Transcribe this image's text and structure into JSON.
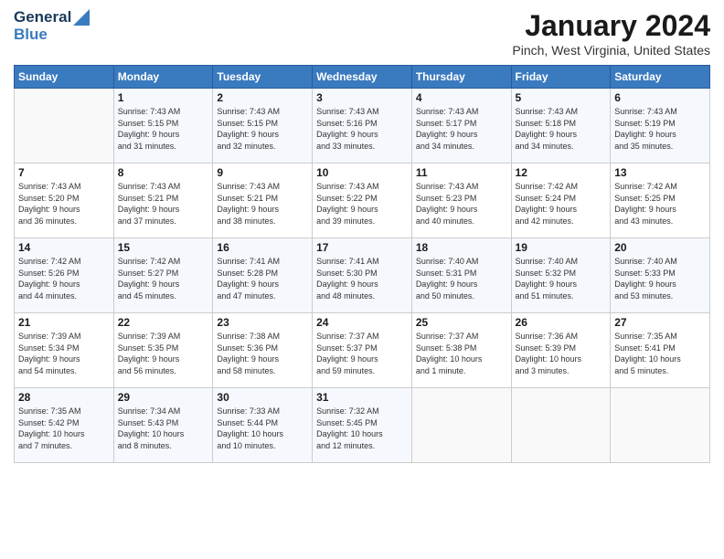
{
  "header": {
    "logo_line1": "General",
    "logo_line2": "Blue",
    "month_title": "January 2024",
    "location": "Pinch, West Virginia, United States"
  },
  "weekdays": [
    "Sunday",
    "Monday",
    "Tuesday",
    "Wednesday",
    "Thursday",
    "Friday",
    "Saturday"
  ],
  "weeks": [
    [
      {
        "day": "",
        "info": ""
      },
      {
        "day": "1",
        "info": "Sunrise: 7:43 AM\nSunset: 5:15 PM\nDaylight: 9 hours\nand 31 minutes."
      },
      {
        "day": "2",
        "info": "Sunrise: 7:43 AM\nSunset: 5:15 PM\nDaylight: 9 hours\nand 32 minutes."
      },
      {
        "day": "3",
        "info": "Sunrise: 7:43 AM\nSunset: 5:16 PM\nDaylight: 9 hours\nand 33 minutes."
      },
      {
        "day": "4",
        "info": "Sunrise: 7:43 AM\nSunset: 5:17 PM\nDaylight: 9 hours\nand 34 minutes."
      },
      {
        "day": "5",
        "info": "Sunrise: 7:43 AM\nSunset: 5:18 PM\nDaylight: 9 hours\nand 34 minutes."
      },
      {
        "day": "6",
        "info": "Sunrise: 7:43 AM\nSunset: 5:19 PM\nDaylight: 9 hours\nand 35 minutes."
      }
    ],
    [
      {
        "day": "7",
        "info": "Sunrise: 7:43 AM\nSunset: 5:20 PM\nDaylight: 9 hours\nand 36 minutes."
      },
      {
        "day": "8",
        "info": "Sunrise: 7:43 AM\nSunset: 5:21 PM\nDaylight: 9 hours\nand 37 minutes."
      },
      {
        "day": "9",
        "info": "Sunrise: 7:43 AM\nSunset: 5:21 PM\nDaylight: 9 hours\nand 38 minutes."
      },
      {
        "day": "10",
        "info": "Sunrise: 7:43 AM\nSunset: 5:22 PM\nDaylight: 9 hours\nand 39 minutes."
      },
      {
        "day": "11",
        "info": "Sunrise: 7:43 AM\nSunset: 5:23 PM\nDaylight: 9 hours\nand 40 minutes."
      },
      {
        "day": "12",
        "info": "Sunrise: 7:42 AM\nSunset: 5:24 PM\nDaylight: 9 hours\nand 42 minutes."
      },
      {
        "day": "13",
        "info": "Sunrise: 7:42 AM\nSunset: 5:25 PM\nDaylight: 9 hours\nand 43 minutes."
      }
    ],
    [
      {
        "day": "14",
        "info": "Sunrise: 7:42 AM\nSunset: 5:26 PM\nDaylight: 9 hours\nand 44 minutes."
      },
      {
        "day": "15",
        "info": "Sunrise: 7:42 AM\nSunset: 5:27 PM\nDaylight: 9 hours\nand 45 minutes."
      },
      {
        "day": "16",
        "info": "Sunrise: 7:41 AM\nSunset: 5:28 PM\nDaylight: 9 hours\nand 47 minutes."
      },
      {
        "day": "17",
        "info": "Sunrise: 7:41 AM\nSunset: 5:30 PM\nDaylight: 9 hours\nand 48 minutes."
      },
      {
        "day": "18",
        "info": "Sunrise: 7:40 AM\nSunset: 5:31 PM\nDaylight: 9 hours\nand 50 minutes."
      },
      {
        "day": "19",
        "info": "Sunrise: 7:40 AM\nSunset: 5:32 PM\nDaylight: 9 hours\nand 51 minutes."
      },
      {
        "day": "20",
        "info": "Sunrise: 7:40 AM\nSunset: 5:33 PM\nDaylight: 9 hours\nand 53 minutes."
      }
    ],
    [
      {
        "day": "21",
        "info": "Sunrise: 7:39 AM\nSunset: 5:34 PM\nDaylight: 9 hours\nand 54 minutes."
      },
      {
        "day": "22",
        "info": "Sunrise: 7:39 AM\nSunset: 5:35 PM\nDaylight: 9 hours\nand 56 minutes."
      },
      {
        "day": "23",
        "info": "Sunrise: 7:38 AM\nSunset: 5:36 PM\nDaylight: 9 hours\nand 58 minutes."
      },
      {
        "day": "24",
        "info": "Sunrise: 7:37 AM\nSunset: 5:37 PM\nDaylight: 9 hours\nand 59 minutes."
      },
      {
        "day": "25",
        "info": "Sunrise: 7:37 AM\nSunset: 5:38 PM\nDaylight: 10 hours\nand 1 minute."
      },
      {
        "day": "26",
        "info": "Sunrise: 7:36 AM\nSunset: 5:39 PM\nDaylight: 10 hours\nand 3 minutes."
      },
      {
        "day": "27",
        "info": "Sunrise: 7:35 AM\nSunset: 5:41 PM\nDaylight: 10 hours\nand 5 minutes."
      }
    ],
    [
      {
        "day": "28",
        "info": "Sunrise: 7:35 AM\nSunset: 5:42 PM\nDaylight: 10 hours\nand 7 minutes."
      },
      {
        "day": "29",
        "info": "Sunrise: 7:34 AM\nSunset: 5:43 PM\nDaylight: 10 hours\nand 8 minutes."
      },
      {
        "day": "30",
        "info": "Sunrise: 7:33 AM\nSunset: 5:44 PM\nDaylight: 10 hours\nand 10 minutes."
      },
      {
        "day": "31",
        "info": "Sunrise: 7:32 AM\nSunset: 5:45 PM\nDaylight: 10 hours\nand 12 minutes."
      },
      {
        "day": "",
        "info": ""
      },
      {
        "day": "",
        "info": ""
      },
      {
        "day": "",
        "info": ""
      }
    ]
  ]
}
